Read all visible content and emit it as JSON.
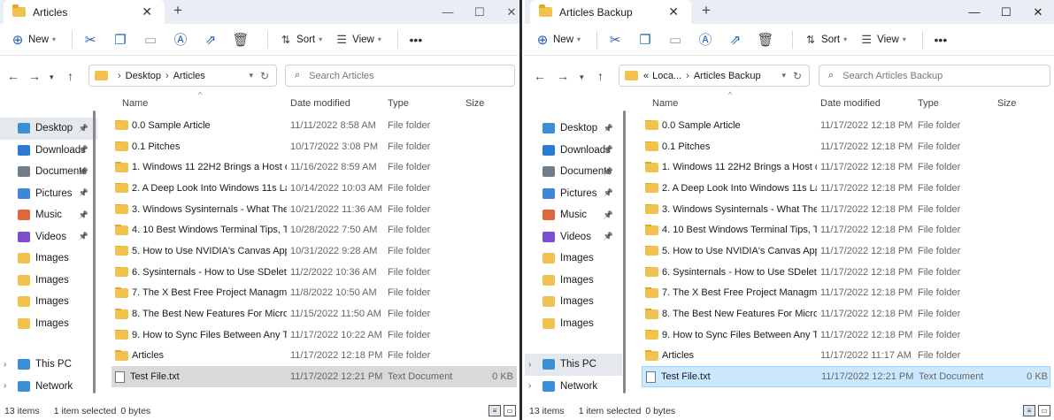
{
  "left": {
    "tab": "Articles",
    "toolbar": {
      "new": "New",
      "sort": "Sort",
      "view": "View"
    },
    "path": [
      "Desktop",
      "Articles"
    ],
    "search_placeholder": "Search Articles",
    "nav": [
      {
        "label": "Desktop",
        "pinned": true,
        "selected": true,
        "color": "#3a8fd8"
      },
      {
        "label": "Downloads",
        "pinned": true,
        "color": "#2a7ad4"
      },
      {
        "label": "Documents",
        "pinned": true,
        "color": "#6f7d8c"
      },
      {
        "label": "Pictures",
        "pinned": true,
        "color": "#3f87d6"
      },
      {
        "label": "Music",
        "pinned": true,
        "color": "#e0673a"
      },
      {
        "label": "Videos",
        "pinned": true,
        "color": "#7c4dcc"
      },
      {
        "label": "Images",
        "color": "#f1c24e"
      },
      {
        "label": "Images",
        "color": "#f1c24e"
      },
      {
        "label": "Images",
        "color": "#f1c24e"
      },
      {
        "label": "Images",
        "color": "#f1c24e"
      }
    ],
    "tree": [
      "This PC",
      "Network"
    ],
    "columns": [
      "Name",
      "Date modified",
      "Type",
      "Size"
    ],
    "rows": [
      {
        "name": "0.0 Sample Article",
        "date": "11/11/2022 8:58 AM",
        "type": "File folder",
        "size": ""
      },
      {
        "name": "0.1 Pitches",
        "date": "10/17/2022 3:08 PM",
        "type": "File folder",
        "size": ""
      },
      {
        "name": "1. Windows 11 22H2 Brings a Host of Ne...",
        "date": "11/16/2022 8:59 AM",
        "type": "File folder",
        "size": ""
      },
      {
        "name": "2. A Deep Look Into Windows 11s Latest ...",
        "date": "10/14/2022 10:03 AM",
        "type": "File folder",
        "size": ""
      },
      {
        "name": "3. Windows Sysinternals - What They Are ...",
        "date": "10/21/2022 11:36 AM",
        "type": "File folder",
        "size": ""
      },
      {
        "name": "4. 10 Best Windows Terminal Tips, Tricks, ...",
        "date": "10/28/2022 7:50 AM",
        "type": "File folder",
        "size": ""
      },
      {
        "name": "5. How to Use NVIDIA's Canvas App to T...",
        "date": "10/31/2022 9:28 AM",
        "type": "File folder",
        "size": ""
      },
      {
        "name": "6. Sysinternals - How to Use SDelete to Se...",
        "date": "11/2/2022 10:36 AM",
        "type": "File folder",
        "size": ""
      },
      {
        "name": "7. The X Best Free Project Managment To...",
        "date": "11/8/2022 10:50 AM",
        "type": "File folder",
        "size": ""
      },
      {
        "name": "8. The Best New Features For Microsoft T...",
        "date": "11/15/2022 11:50 AM",
        "type": "File folder",
        "size": ""
      },
      {
        "name": "9. How to Sync Files Between Any Two W...",
        "date": "11/17/2022 10:22 AM",
        "type": "File folder",
        "size": ""
      },
      {
        "name": "Articles",
        "date": "11/17/2022 12:18 PM",
        "type": "File folder",
        "size": ""
      },
      {
        "name": "Test File.txt",
        "date": "11/17/2022 12:21 PM",
        "type": "Text Document",
        "size": "0 KB",
        "file": true,
        "selected": true
      }
    ],
    "status": {
      "items": "13 items",
      "selected": "1 item selected",
      "bytes": "0 bytes"
    }
  },
  "right": {
    "tab": "Articles Backup",
    "toolbar": {
      "new": "New",
      "sort": "Sort",
      "view": "View"
    },
    "path": [
      "«",
      "Loca...",
      "Articles Backup"
    ],
    "search_placeholder": "Search Articles Backup",
    "nav": [
      {
        "label": "Desktop",
        "pinned": true,
        "color": "#3a8fd8"
      },
      {
        "label": "Downloads",
        "pinned": true,
        "color": "#2a7ad4"
      },
      {
        "label": "Documents",
        "pinned": true,
        "color": "#6f7d8c"
      },
      {
        "label": "Pictures",
        "pinned": true,
        "color": "#3f87d6"
      },
      {
        "label": "Music",
        "pinned": true,
        "color": "#e0673a"
      },
      {
        "label": "Videos",
        "pinned": true,
        "color": "#7c4dcc"
      },
      {
        "label": "Images",
        "color": "#f1c24e"
      },
      {
        "label": "Images",
        "color": "#f1c24e"
      },
      {
        "label": "Images",
        "color": "#f1c24e"
      },
      {
        "label": "Images",
        "color": "#f1c24e"
      }
    ],
    "tree": [
      "This PC",
      "Network"
    ],
    "columns": [
      "Name",
      "Date modified",
      "Type",
      "Size"
    ],
    "rows": [
      {
        "name": "0.0 Sample Article",
        "date": "11/17/2022 12:18 PM",
        "type": "File folder",
        "size": ""
      },
      {
        "name": "0.1 Pitches",
        "date": "11/17/2022 12:18 PM",
        "type": "File folder",
        "size": ""
      },
      {
        "name": "1. Windows 11 22H2 Brings a Host of Ne...",
        "date": "11/17/2022 12:18 PM",
        "type": "File folder",
        "size": ""
      },
      {
        "name": "2. A Deep Look Into Windows 11s Latest ...",
        "date": "11/17/2022 12:18 PM",
        "type": "File folder",
        "size": ""
      },
      {
        "name": "3. Windows Sysinternals - What They Are ...",
        "date": "11/17/2022 12:18 PM",
        "type": "File folder",
        "size": ""
      },
      {
        "name": "4. 10 Best Windows Terminal Tips, Tricks, ...",
        "date": "11/17/2022 12:18 PM",
        "type": "File folder",
        "size": ""
      },
      {
        "name": "5. How to Use NVIDIA's Canvas App to T...",
        "date": "11/17/2022 12:18 PM",
        "type": "File folder",
        "size": ""
      },
      {
        "name": "6. Sysinternals - How to Use SDelete to Se...",
        "date": "11/17/2022 12:18 PM",
        "type": "File folder",
        "size": ""
      },
      {
        "name": "7. The X Best Free Project Managment To...",
        "date": "11/17/2022 12:18 PM",
        "type": "File folder",
        "size": ""
      },
      {
        "name": "8. The Best New Features For Microsoft T...",
        "date": "11/17/2022 12:18 PM",
        "type": "File folder",
        "size": ""
      },
      {
        "name": "9. How to Sync Files Between Any Two W...",
        "date": "11/17/2022 12:18 PM",
        "type": "File folder",
        "size": ""
      },
      {
        "name": "Articles",
        "date": "11/17/2022 11:17 AM",
        "type": "File folder",
        "size": ""
      },
      {
        "name": "Test File.txt",
        "date": "11/17/2022 12:21 PM",
        "type": "Text Document",
        "size": "0 KB",
        "file": true,
        "selected": true
      }
    ],
    "status": {
      "items": "13 items",
      "selected": "1 item selected",
      "bytes": "0 bytes"
    }
  }
}
